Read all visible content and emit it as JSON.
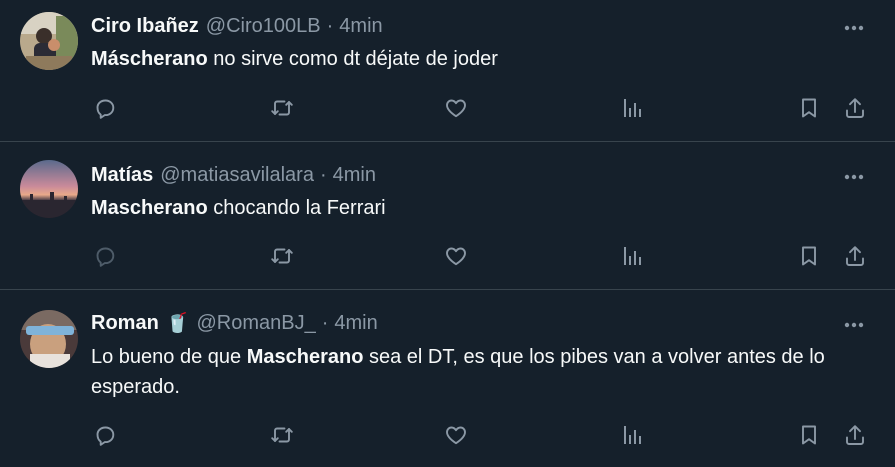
{
  "tweets": [
    {
      "name": "Ciro Ibañez",
      "emoji": "",
      "handle": "@Ciro100LB",
      "dot": "·",
      "time": "4min",
      "text_parts": [
        {
          "bold": true,
          "text": "Máscherano"
        },
        {
          "bold": false,
          "text": " no sirve como  dt déjate de joder"
        }
      ]
    },
    {
      "name": "Matías",
      "emoji": "",
      "handle": "@matiasavilalara",
      "dot": "·",
      "time": "4min",
      "text_parts": [
        {
          "bold": true,
          "text": "Mascherano"
        },
        {
          "bold": false,
          "text": " chocando la Ferrari"
        }
      ]
    },
    {
      "name": "Roman",
      "emoji": "🥤",
      "handle": "@RomanBJ_",
      "dot": "·",
      "time": "4min",
      "text_parts": [
        {
          "bold": false,
          "text": "Lo bueno de que "
        },
        {
          "bold": true,
          "text": "Mascherano"
        },
        {
          "bold": false,
          "text": " sea el DT, es que los pibes van a volver antes de lo esperado."
        }
      ]
    }
  ],
  "icons": {
    "reply": "reply-icon",
    "retweet": "retweet-icon",
    "like": "like-icon",
    "views": "views-icon",
    "bookmark": "bookmark-icon",
    "share": "share-icon",
    "more": "more-icon"
  },
  "colors": {
    "background": "#15202b",
    "text": "#f7f9f9",
    "secondary": "#8b98a5",
    "divider": "#38444d"
  }
}
